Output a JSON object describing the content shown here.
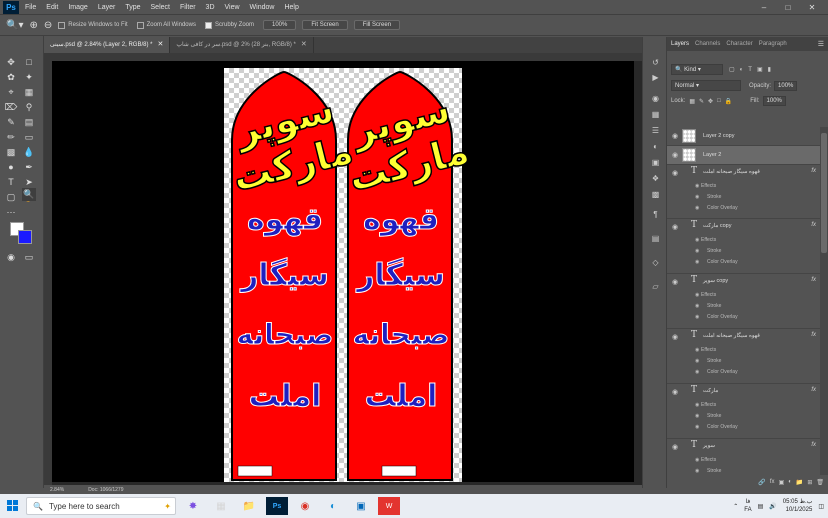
{
  "app": {
    "logo": "Ps",
    "menus": [
      "File",
      "Edit",
      "Image",
      "Layer",
      "Type",
      "Select",
      "Filter",
      "3D",
      "View",
      "Window",
      "Help"
    ]
  },
  "options": {
    "resize_windows": "Resize Windows to Fit",
    "zoom_all": "Zoom All Windows",
    "scrubby_zoom": "Scrubby Zoom",
    "zoom_value": "100%",
    "fit_screen": "Fit Screen",
    "fill_screen": "Fill Screen"
  },
  "tabs": [
    {
      "label": "سینی.psd @ 2.84% (Layer 2, RGB/8) *",
      "active": true
    },
    {
      "label": "سر در کافی شاپ.psd @ 2% (28 بنر, RGB/8) *",
      "active": false
    }
  ],
  "banner": {
    "heading_line1": "سوپر",
    "heading_line2": "مارکت",
    "items": [
      "قهوه",
      "سیگار",
      "صبحانه",
      "املت"
    ],
    "footer_label": "",
    "colors": {
      "red": "#ff0000",
      "yellow": "#ffff33",
      "blue": "#1f1fbf"
    }
  },
  "statusbar": {
    "zoom": "2.84%",
    "doc": "Doc: 1066/1279"
  },
  "layers_panel": {
    "tabs": [
      "Layers",
      "Channels",
      "Character",
      "Paragraph"
    ],
    "kind_label": "Kind",
    "blend_mode": "Normal",
    "opacity_label": "Opacity:",
    "opacity_value": "100%",
    "lock_label": "Lock:",
    "fill_label": "Fill:",
    "fill_value": "100%",
    "layers": [
      {
        "name": "Layer 2 copy",
        "type": "pixel",
        "fx": false
      },
      {
        "name": "Layer 2",
        "type": "pixel",
        "fx": false,
        "selected": true
      },
      {
        "name": "قهوه سیگار صبحانه املت",
        "type": "text",
        "fx": true,
        "effects": [
          "Effects",
          "Stroke",
          "Color Overlay"
        ]
      },
      {
        "name": "مارکت copy",
        "type": "text",
        "fx": true,
        "effects": [
          "Effects",
          "Stroke",
          "Color Overlay"
        ]
      },
      {
        "name": "سوپر copy",
        "type": "text",
        "fx": true,
        "effects": [
          "Effects",
          "Stroke",
          "Color Overlay"
        ]
      },
      {
        "name": "قهوه سیگار صبحانه املت",
        "type": "text",
        "fx": true,
        "effects": [
          "Effects",
          "Stroke",
          "Color Overlay"
        ]
      },
      {
        "name": "مارکت",
        "type": "text",
        "fx": true,
        "effects": [
          "Effects",
          "Stroke",
          "Color Overlay"
        ]
      },
      {
        "name": "سوپر",
        "type": "text",
        "fx": true,
        "effects": [
          "Effects",
          "Stroke",
          "Color Overlay"
        ]
      }
    ],
    "fx_label": "fx"
  },
  "taskbar": {
    "search_placeholder": "Type here to search",
    "time": "05:05 ب.ظ",
    "date": "10/1/2025",
    "lang": "FA",
    "lang2": "فا"
  }
}
